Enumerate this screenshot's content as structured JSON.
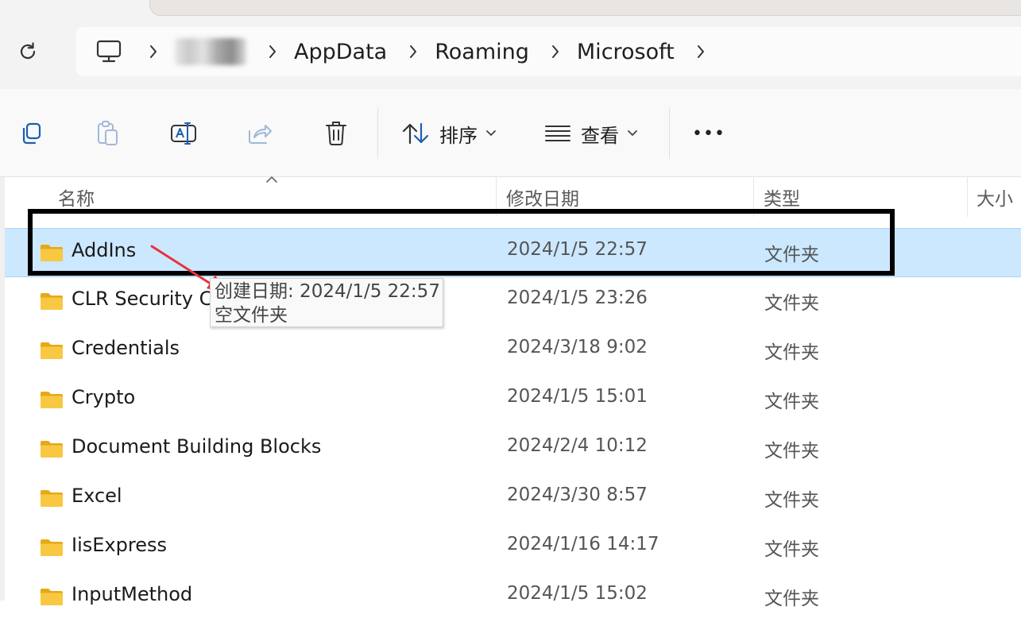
{
  "address": {
    "breadcrumbs": [
      "AppData",
      "Roaming",
      "Microsoft"
    ],
    "root_icon": "computer-icon",
    "user_segment": "redacted"
  },
  "toolbar": {
    "buttons": [
      {
        "name": "copy",
        "icon": "copy-icon"
      },
      {
        "name": "paste",
        "icon": "paste-icon"
      },
      {
        "name": "rename",
        "icon": "rename-icon"
      },
      {
        "name": "share",
        "icon": "share-icon"
      },
      {
        "name": "delete",
        "icon": "trash-icon"
      }
    ],
    "sort_label": "排序",
    "view_label": "查看",
    "more_label": "•••"
  },
  "columns": {
    "name": "名称",
    "date": "修改日期",
    "type": "类型",
    "size": "大小"
  },
  "files": [
    {
      "name": "AddIns",
      "date": "2024/1/5 22:57",
      "type": "文件夹",
      "selected": true
    },
    {
      "name": "CLR Security Co",
      "date": "2024/1/5 23:26",
      "type": "文件夹"
    },
    {
      "name": "Credentials",
      "date": "2024/3/18 9:02",
      "type": "文件夹"
    },
    {
      "name": "Crypto",
      "date": "2024/1/5 15:01",
      "type": "文件夹"
    },
    {
      "name": "Document Building Blocks",
      "date": "2024/2/4 10:12",
      "type": "文件夹"
    },
    {
      "name": "Excel",
      "date": "2024/3/30 8:57",
      "type": "文件夹"
    },
    {
      "name": "IisExpress",
      "date": "2024/1/16 14:17",
      "type": "文件夹"
    },
    {
      "name": "InputMethod",
      "date": "2024/1/5 15:02",
      "type": "文件夹"
    }
  ],
  "tooltip": {
    "line1": "创建日期: 2024/1/5 22:57",
    "line2": "空文件夹"
  },
  "colors": {
    "selection": "#cce8ff",
    "folder": "#f8c843",
    "annotation_arrow": "#e8323c",
    "annotation_box": "#000000"
  }
}
